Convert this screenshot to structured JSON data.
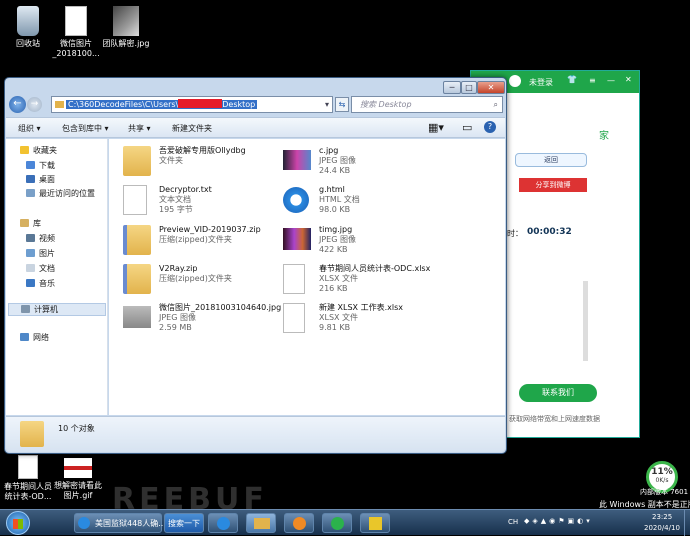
{
  "desktop": {
    "icons": [
      {
        "label": "回收站"
      },
      {
        "label": "微信图片\n_2018100..."
      },
      {
        "label": "团队解密.jpg"
      },
      {
        "label": "春节期间人员\n统计表-OD..."
      },
      {
        "label": "想解密请看此\n图片.gif"
      }
    ],
    "watermark": "REEBUF",
    "activation": "此 Windows 副本不是正版",
    "activation_partial": "内部版本 7601"
  },
  "bg_app": {
    "login": "未登录",
    "back_button": "返回",
    "share_button": "分享到微博",
    "timer_label": "时：",
    "timer_value": "00:00:32",
    "contact_button": "联系我们",
    "footer_text": "获取网络带宽和上网速度数据",
    "side_text": "家"
  },
  "explorer": {
    "address": "C:\\360DecodeFiles\\C\\Users\\",
    "address_tail": "Desktop",
    "search_placeholder": "搜索 Desktop",
    "toolbar": {
      "organize": "组织 ▾",
      "include": "包含到库中 ▾",
      "share": "共享 ▾",
      "new_folder": "新建文件夹"
    },
    "nav": {
      "favorites": "收藏夹",
      "downloads": "下载",
      "desktop": "桌面",
      "recent": "最近访问的位置",
      "library": "库",
      "videos": "视频",
      "pictures": "图片",
      "documents": "文档",
      "music": "音乐",
      "computer": "计算机",
      "network": "网络"
    },
    "files": [
      {
        "name": "吾爱破解专用版Ollydbg",
        "type": "文件夹",
        "size": "",
        "icon": "folder-icon"
      },
      {
        "name": "c.jpg",
        "type": "JPEG 图像",
        "size": "24.4 KB",
        "icon": "image-icon"
      },
      {
        "name": "Decryptor.txt",
        "type": "文本文档",
        "size": "195 字节",
        "icon": "text-file-icon"
      },
      {
        "name": "g.html",
        "type": "HTML 文档",
        "size": "98.0 KB",
        "icon": "ie-icon"
      },
      {
        "name": "Preview_VID-2019037.zip",
        "type": "压缩(zipped)文件夹",
        "size": "",
        "icon": "zip-icon"
      },
      {
        "name": "timg.jpg",
        "type": "JPEG 图像",
        "size": "422 KB",
        "icon": "image-icon"
      },
      {
        "name": "V2Ray.zip",
        "type": "压缩(zipped)文件夹",
        "size": "",
        "icon": "zip-icon"
      },
      {
        "name": "春节期间人员统计表-ODC.xlsx",
        "type": "XLSX 文件",
        "size": "216 KB",
        "icon": "xlsx-icon"
      },
      {
        "name": "微信图片_20181003104640.jpg",
        "type": "JPEG 图像",
        "size": "2.59 MB",
        "icon": "image-icon"
      },
      {
        "name": "新建 XLSX 工作表.xlsx",
        "type": "XLSX 文件",
        "size": "9.81 KB",
        "icon": "xlsx-icon"
      }
    ],
    "status": "10 个对象"
  },
  "taskbar": {
    "task1": "美国监狱448人确...",
    "task2": "搜索一下",
    "lang": "CH",
    "time": "23:25",
    "date": "2020/4/10",
    "net_percent": "11%",
    "net_speed": "0K/s"
  }
}
